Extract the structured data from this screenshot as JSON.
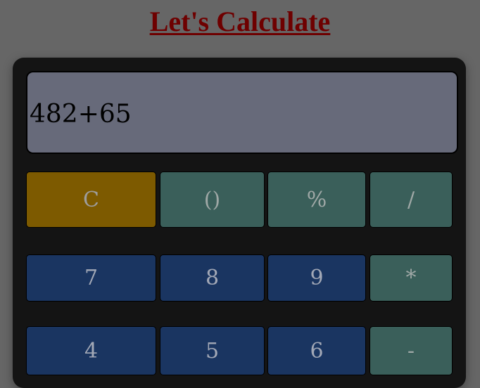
{
  "header": {
    "title": "Let's Calculate"
  },
  "display": {
    "value": "482+65"
  },
  "keys": {
    "clear": "C",
    "parens": "()",
    "percent": "%",
    "divide": "/",
    "seven": "7",
    "eight": "8",
    "nine": "9",
    "multiply": "*",
    "four": "4",
    "five": "5",
    "six": "6",
    "subtract": "-"
  },
  "colors": {
    "page_background": "#666666",
    "title": "#6e0000",
    "calculator_body": "#141414",
    "display_background": "#676a7a",
    "clear_key": "#7d5a00",
    "operator_key": "#3a5f5a",
    "number_key": "#1a3561"
  }
}
